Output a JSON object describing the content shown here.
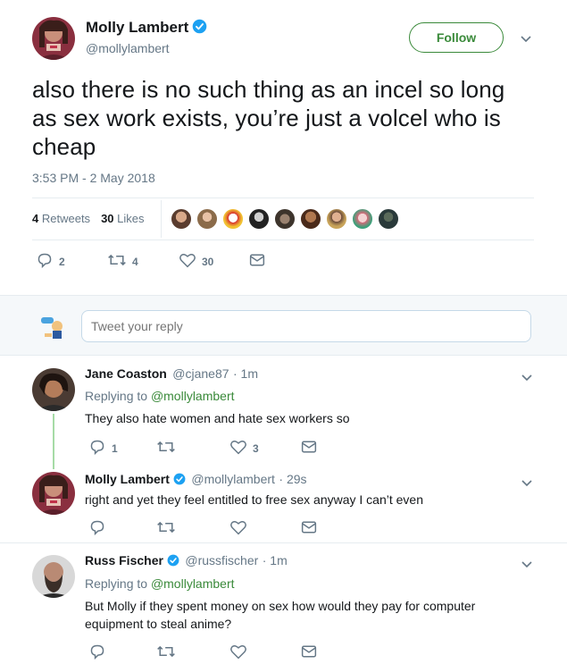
{
  "tweet": {
    "author_name": "Molly Lambert",
    "author_handle": "@mollylambert",
    "follow_label": "Follow",
    "text": "also there is no such thing as an incel so long as sex work exists, you’re just a volcel who is cheap",
    "timestamp": "3:53 PM - 2 May 2018",
    "retweets_count": "4",
    "retweets_label": "Retweets",
    "likes_count": "30",
    "likes_label": "Likes",
    "actions": {
      "replies": "2",
      "retweets": "4",
      "likes": "30"
    }
  },
  "reply_box": {
    "placeholder": "Tweet your reply"
  },
  "replies": [
    {
      "name": "Jane Coaston",
      "handle": "@cjane87",
      "time": "· 1m",
      "replying_to_prefix": "Replying to",
      "replying_to": "@mollylambert",
      "text": "They also hate women and hate sex workers so",
      "replies": "1",
      "retweets": "",
      "likes": "3"
    },
    {
      "name": "Molly Lambert",
      "handle": "@mollylambert",
      "time": "· 29s",
      "text": "right and yet they feel entitled to free sex anyway I can’t even",
      "replies": "",
      "retweets": "",
      "likes": ""
    },
    {
      "name": "Russ Fischer",
      "handle": "@russfischer",
      "time": "· 1m",
      "replying_to_prefix": "Replying to",
      "replying_to": "@mollylambert",
      "text_line1": "But Molly if they spent money on sex how would they pay for computer",
      "text_line2": "equipment to steal anime?",
      "replies": "",
      "retweets": "",
      "likes": ""
    }
  ],
  "colors": {
    "accent_green": "#3a8a3a",
    "verified_blue": "#1da1f2",
    "muted": "#657786",
    "divider": "#e6ecf0"
  },
  "icons": [
    "verified-icon",
    "chevron-down-icon",
    "reply-icon",
    "retweet-icon",
    "like-icon",
    "message-icon"
  ]
}
